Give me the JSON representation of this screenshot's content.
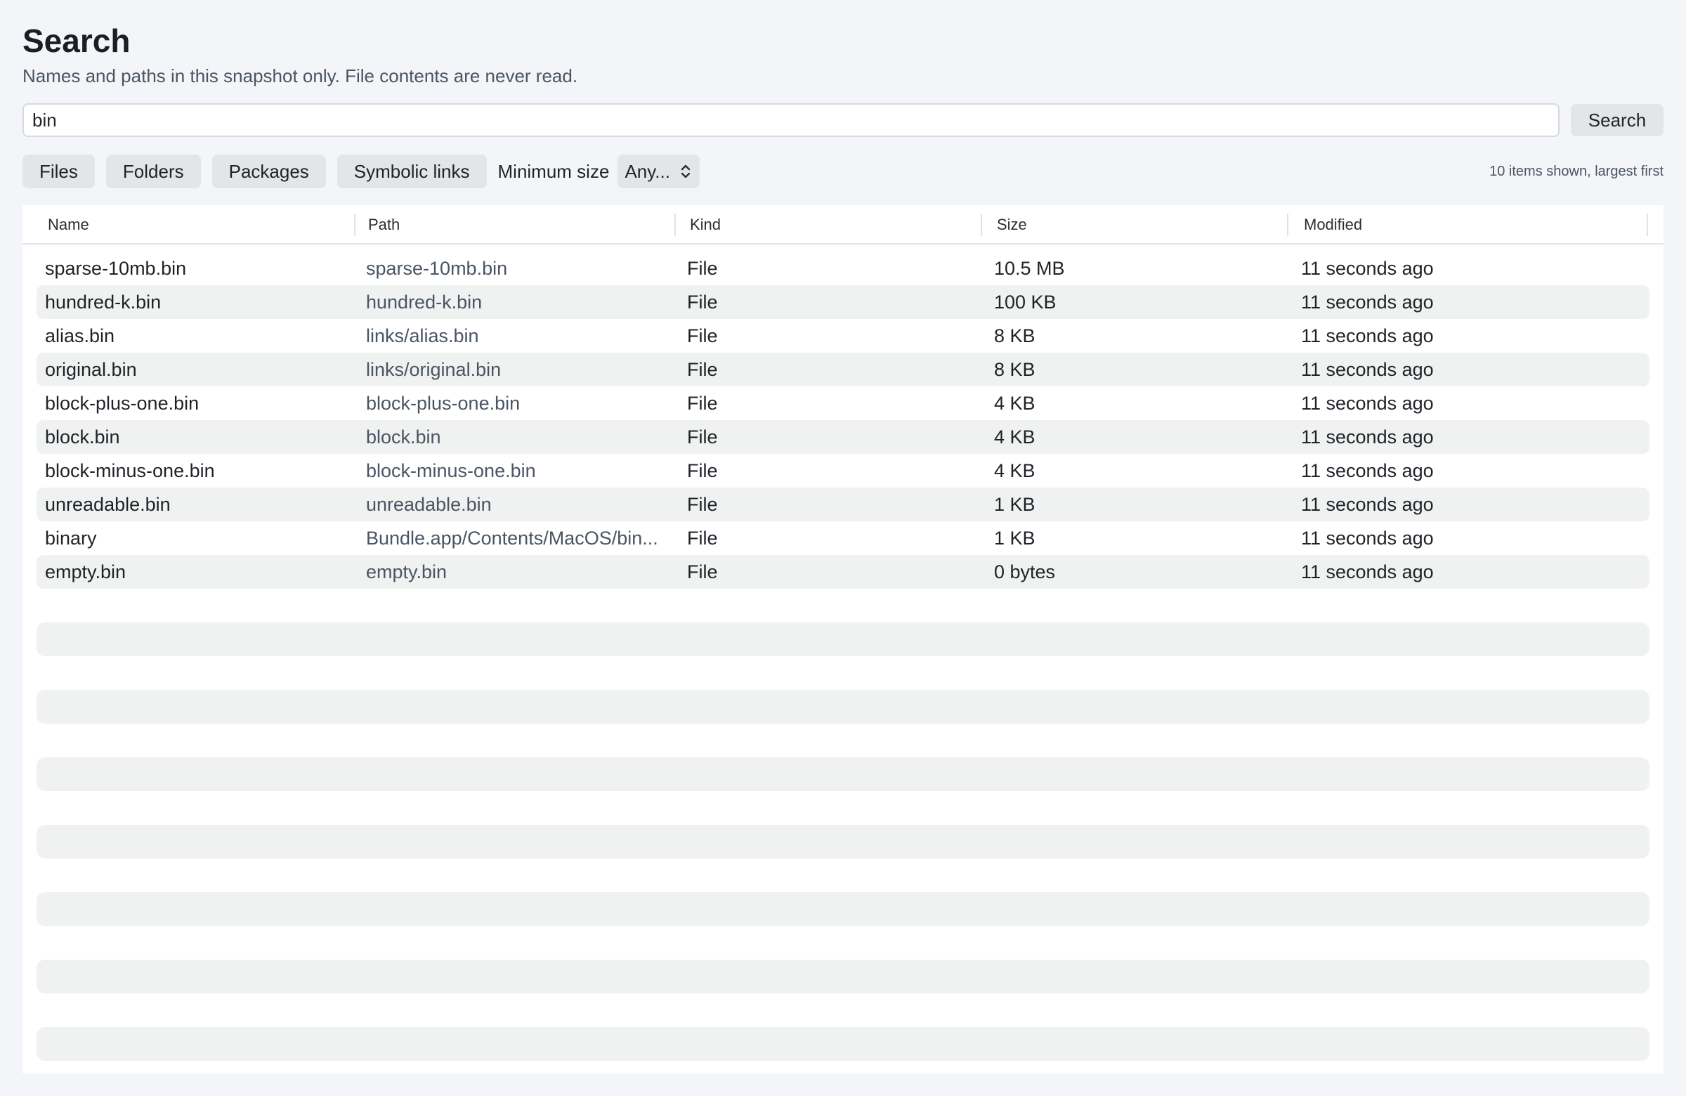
{
  "header": {
    "title": "Search",
    "subtitle": "Names and paths in this snapshot only. File contents are never read."
  },
  "search": {
    "value": "bin",
    "button_label": "Search"
  },
  "filters": {
    "chips": [
      "Files",
      "Folders",
      "Packages",
      "Symbolic links"
    ],
    "min_size_label": "Minimum size",
    "min_size_value": "Any..."
  },
  "status": {
    "count_text": "10 items shown, largest first"
  },
  "table": {
    "columns": [
      "Name",
      "Path",
      "Kind",
      "Size",
      "Modified"
    ],
    "rows": [
      {
        "name": "sparse-10mb.bin",
        "path": "sparse-10mb.bin",
        "kind": "File",
        "size": "10.5 MB",
        "modified": "11 seconds ago"
      },
      {
        "name": "hundred-k.bin",
        "path": "hundred-k.bin",
        "kind": "File",
        "size": "100 KB",
        "modified": "11 seconds ago"
      },
      {
        "name": "alias.bin",
        "path": "links/alias.bin",
        "kind": "File",
        "size": "8 KB",
        "modified": "11 seconds ago"
      },
      {
        "name": "original.bin",
        "path": "links/original.bin",
        "kind": "File",
        "size": "8 KB",
        "modified": "11 seconds ago"
      },
      {
        "name": "block-plus-one.bin",
        "path": "block-plus-one.bin",
        "kind": "File",
        "size": "4 KB",
        "modified": "11 seconds ago"
      },
      {
        "name": "block.bin",
        "path": "block.bin",
        "kind": "File",
        "size": "4 KB",
        "modified": "11 seconds ago"
      },
      {
        "name": "block-minus-one.bin",
        "path": "block-minus-one.bin",
        "kind": "File",
        "size": "4 KB",
        "modified": "11 seconds ago"
      },
      {
        "name": "unreadable.bin",
        "path": "unreadable.bin",
        "kind": "File",
        "size": "1 KB",
        "modified": "11 seconds ago"
      },
      {
        "name": "binary",
        "path": "Bundle.app/Contents/MacOS/bin...",
        "kind": "File",
        "size": "1 KB",
        "modified": "11 seconds ago"
      },
      {
        "name": "empty.bin",
        "path": "empty.bin",
        "kind": "File",
        "size": "0 bytes",
        "modified": "11 seconds ago"
      }
    ]
  }
}
